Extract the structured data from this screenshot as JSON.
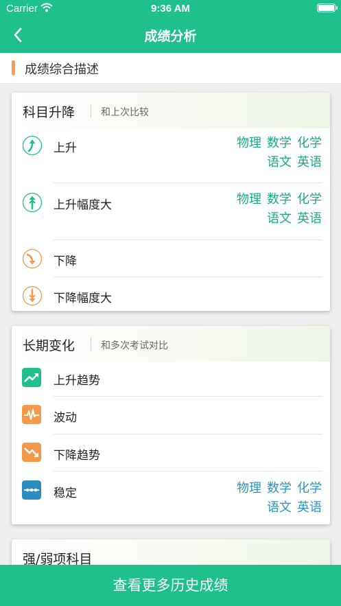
{
  "status_bar": {
    "carrier": "Carrier",
    "time": "9:36 AM"
  },
  "nav": {
    "title": "成绩分析",
    "back_icon": "chevron-left-icon"
  },
  "section": {
    "title": "成绩综合描述",
    "accent": "#f6a04d"
  },
  "colors": {
    "primary": "#1ec08b",
    "rise": "#1ec08b",
    "fall": "#f39a4a",
    "stable": "#2b8cbf"
  },
  "card1": {
    "title": "科目升降",
    "subtitle": "和上次比较",
    "rows": [
      {
        "label": "上升",
        "icon": "arrow-up-circle-icon",
        "subjects_line1": [
          "物理",
          "数学",
          "化学"
        ],
        "subjects_line2": [
          "语文",
          "英语"
        ]
      },
      {
        "label": "上升幅度大",
        "icon": "double-arrow-up-circle-icon",
        "subjects_line1": [
          "物理",
          "数学",
          "化学"
        ],
        "subjects_line2": [
          "语文",
          "英语"
        ]
      },
      {
        "label": "下降",
        "icon": "arrow-down-circle-icon"
      },
      {
        "label": "下降幅度大",
        "icon": "double-arrow-down-circle-icon"
      }
    ]
  },
  "card2": {
    "title": "长期变化",
    "subtitle": "和多次考试对比",
    "rows": [
      {
        "label": "上升趋势",
        "icon": "trend-up-icon"
      },
      {
        "label": "波动",
        "icon": "fluctuation-icon"
      },
      {
        "label": "下降趋势",
        "icon": "trend-down-icon"
      },
      {
        "label": "稳定",
        "icon": "stable-icon",
        "subjects_line1": [
          "物理",
          "数学",
          "化学"
        ],
        "subjects_line2": [
          "语文",
          "英语"
        ]
      }
    ]
  },
  "card3": {
    "title": "强/弱项科目"
  },
  "bottom_button": {
    "label": "查看更多历史成绩"
  }
}
